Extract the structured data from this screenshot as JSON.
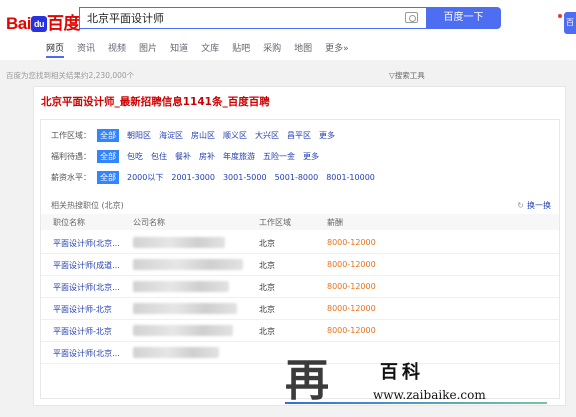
{
  "header": {
    "logo_text_1": "Bai",
    "logo_paw": "du",
    "logo_text_2": "百度",
    "search_value": "北京平面设计师",
    "search_button": "百度一下",
    "corner_button": "百",
    "tabs": [
      {
        "label": "网页",
        "active": true
      },
      {
        "label": "资讯"
      },
      {
        "label": "视频"
      },
      {
        "label": "图片"
      },
      {
        "label": "知道"
      },
      {
        "label": "文库"
      },
      {
        "label": "贴吧"
      },
      {
        "label": "采购"
      },
      {
        "label": "地图"
      },
      {
        "label": "更多»"
      }
    ]
  },
  "results": {
    "count_text": "百度为您找到相关结果约2,230,000个",
    "tools_text": "▽搜索工具"
  },
  "card": {
    "title": "北京平面设计师_最新招聘信息1141条_百度百聘",
    "filters": [
      {
        "label": "工作区域：",
        "options": [
          "全部",
          "朝阳区",
          "海淀区",
          "房山区",
          "顺义区",
          "大兴区",
          "昌平区",
          "更多"
        ]
      },
      {
        "label": "福利待遇：",
        "options": [
          "全部",
          "包吃",
          "包住",
          "餐补",
          "房补",
          "年度旅游",
          "五险一金",
          "更多"
        ]
      },
      {
        "label": "薪资水平：",
        "options": [
          "全部",
          "2000以下",
          "2001-3000",
          "3001-5000",
          "5001-8000",
          "8001-10000"
        ]
      }
    ],
    "hot_title": "相关热搜职位 (北京)",
    "refresh_label": "换一换",
    "columns": [
      "职位名称",
      "公司名称",
      "工作区域",
      "薪酬"
    ],
    "rows": [
      {
        "job": "平面设计师(北京...",
        "area": "北京",
        "salary": "8000-12000"
      },
      {
        "job": "平面设计师(成道...",
        "area": "北京",
        "salary": "8000-12000"
      },
      {
        "job": "平面设计师(北京...",
        "area": "北京",
        "salary": "8000-12000"
      },
      {
        "job": "平面设计师-北京",
        "area": "北京",
        "salary": "8000-12000"
      },
      {
        "job": "平面设计师-北京",
        "area": "北京",
        "salary": "8000-12000"
      },
      {
        "job": "平面设计师(北京...",
        "area": "",
        "salary": ""
      }
    ]
  },
  "watermark": {
    "mark": "再",
    "text": "百科",
    "url": "www.zaibaike.com"
  }
}
